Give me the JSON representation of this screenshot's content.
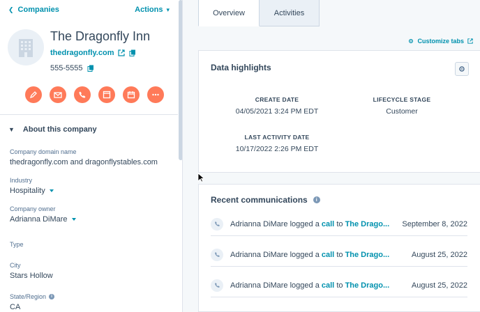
{
  "nav": {
    "back_label": "Companies",
    "actions_label": "Actions"
  },
  "company": {
    "name": "The Dragonfly Inn",
    "domain": "thedragonfly.com",
    "phone": "555-5555"
  },
  "action_buttons": [
    "note-icon",
    "email-icon",
    "call-icon",
    "task-icon",
    "meeting-icon",
    "more-icon"
  ],
  "about": {
    "title": "About this company",
    "properties": [
      {
        "label": "Company domain name",
        "value": "thedragonfly.com and dragonflystables.com"
      },
      {
        "label": "Industry",
        "value": "Hospitality"
      },
      {
        "label": "Company owner",
        "value": "Adrianna DiMare"
      },
      {
        "label": "Type",
        "value": ""
      },
      {
        "label": "City",
        "value": "Stars Hollow"
      },
      {
        "label": "State/Region",
        "value": "CA"
      }
    ]
  },
  "tabs": [
    {
      "label": "Overview",
      "active": true
    },
    {
      "label": "Activities",
      "active": false
    }
  ],
  "customize_label": "Customize tabs",
  "highlights": {
    "title": "Data highlights",
    "items": [
      {
        "label": "CREATE DATE",
        "value": "04/05/2021 3:24 PM EDT"
      },
      {
        "label": "LIFECYCLE STAGE",
        "value": "Customer"
      },
      {
        "label": "LAST ACTIVITY DATE",
        "value": "10/17/2022 2:26 PM EDT"
      }
    ]
  },
  "communications": {
    "title": "Recent communications",
    "rows": [
      {
        "actor": "Adrianna DiMare",
        "verb": "logged a",
        "type": "call",
        "prep": "to",
        "target": "The Drago...",
        "date": "September 8, 2022"
      },
      {
        "actor": "Adrianna DiMare",
        "verb": "logged a",
        "type": "call",
        "prep": "to",
        "target": "The Drago...",
        "date": "August 25, 2022"
      },
      {
        "actor": "Adrianna DiMare",
        "verb": "logged a",
        "type": "call",
        "prep": "to",
        "target": "The Drago...",
        "date": "August 25, 2022"
      }
    ]
  },
  "colors": {
    "accent": "#0091ae",
    "action_orange": "#ff7a59",
    "text": "#33475b"
  }
}
